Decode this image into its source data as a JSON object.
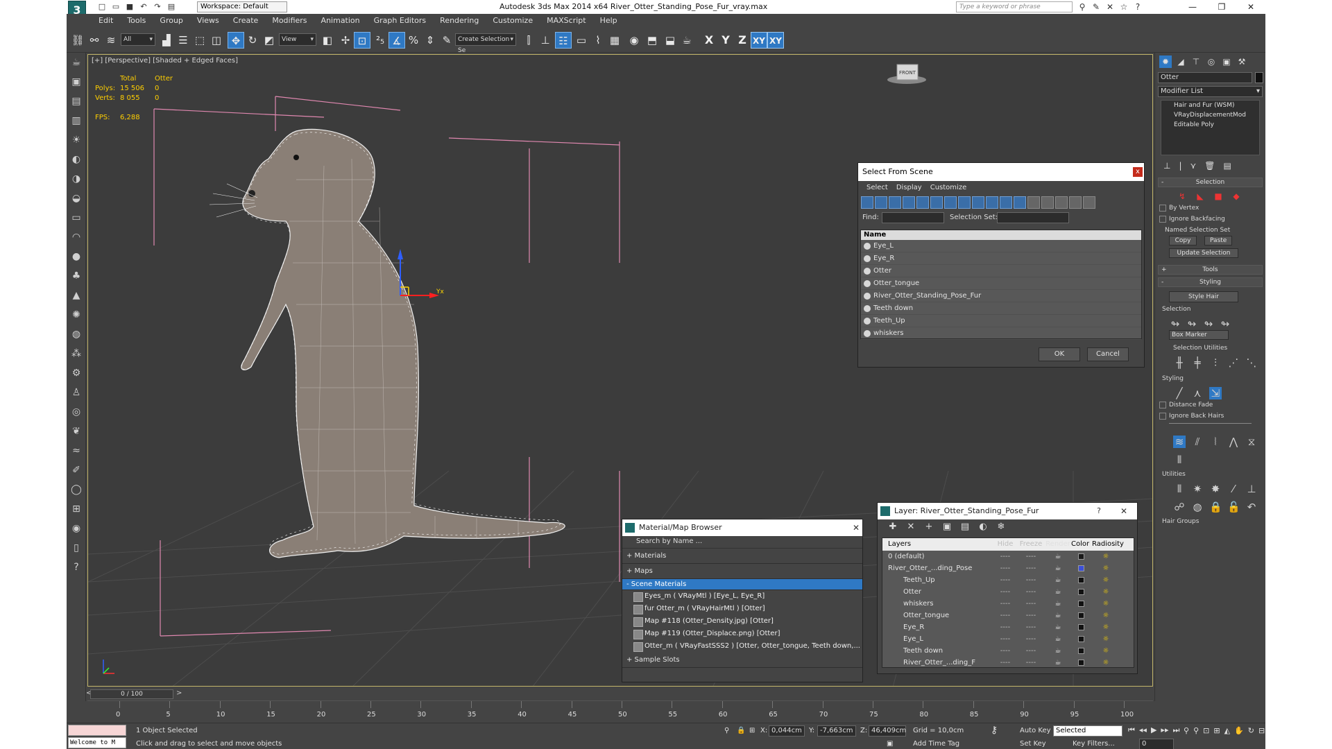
{
  "titlebar": {
    "workspace": "Workspace: Default",
    "title": "Autodesk 3ds Max  2014 x64     River_Otter_Standing_Pose_Fur_vray.max",
    "search_placeholder": "Type a keyword or phrase"
  },
  "menu": [
    "Edit",
    "Tools",
    "Group",
    "Views",
    "Create",
    "Modifiers",
    "Animation",
    "Graph Editors",
    "Rendering",
    "Customize",
    "MAXScript",
    "Help"
  ],
  "toolbar": {
    "filter": "All",
    "ref_coord": "View",
    "selection_set_placeholder": "Create Selection Se",
    "axes": [
      "X",
      "Y",
      "Z",
      "XY",
      "XY"
    ]
  },
  "viewport": {
    "label": "[+] [Perspective] [Shaded + Edged Faces]",
    "stats": {
      "col_total": "Total",
      "col_object": "Otter",
      "polys_label": "Polys:",
      "polys_total": "15 506",
      "polys_obj": "0",
      "verts_label": "Verts:",
      "verts_total": "8 055",
      "verts_obj": "0",
      "fps_label": "FPS:",
      "fps_value": "6,288"
    },
    "gizmo_label": "Yx",
    "viewcube_label": "FRONT"
  },
  "select_from_scene": {
    "title": "Select From Scene",
    "menu": [
      "Select",
      "Display",
      "Customize"
    ],
    "find_label": "Find:",
    "selection_set_label": "Selection Set:",
    "column_name": "Name",
    "items": [
      "Eye_L",
      "Eye_R",
      "Otter",
      "Otter_tongue",
      "River_Otter_Standing_Pose_Fur",
      "Teeth down",
      "Teeth_Up",
      "whiskers"
    ],
    "ok": "OK",
    "cancel": "Cancel"
  },
  "material_browser": {
    "title": "Material/Map Browser",
    "search_placeholder": "Search by Name ...",
    "sections": [
      "+ Materials",
      "+ Maps",
      "- Scene Materials",
      "+ Sample Slots"
    ],
    "scene_materials": [
      "Eyes_m  ( VRayMtl )  [Eye_L, Eye_R]",
      "fur Otter_m  ( VRayHairMtl )  [Otter]",
      "Map #118 (Otter_Density.jpg)  [Otter]",
      "Map #119 (Otter_Displace.png)  [Otter]",
      "Otter_m  ( VRayFastSSS2 )  [Otter, Otter_tongue, Teeth down,..."
    ]
  },
  "layer_manager": {
    "title": "Layer: River_Otter_Standing_Pose_Fur",
    "help": "?",
    "columns": [
      "Layers",
      "Hide",
      "Freeze",
      "Render",
      "Color",
      "Radiosity"
    ],
    "rows": [
      {
        "name": "0 (default)",
        "color": "#1a1a1a"
      },
      {
        "name": "River_Otter_...ding_Pose",
        "color": "#3b4fd8"
      },
      {
        "name": "Teeth_Up",
        "color": "#111111"
      },
      {
        "name": "Otter",
        "color": "#111111"
      },
      {
        "name": "whiskers",
        "color": "#111111"
      },
      {
        "name": "Otter_tongue",
        "color": "#111111"
      },
      {
        "name": "Eye_R",
        "color": "#111111"
      },
      {
        "name": "Eye_L",
        "color": "#111111"
      },
      {
        "name": "Teeth down",
        "color": "#111111"
      },
      {
        "name": "River_Otter_...ding_F",
        "color": "#111111"
      }
    ]
  },
  "command_panel": {
    "object_name": "Otter",
    "modifier_list": "Modifier List",
    "stack": [
      "Hair and Fur (WSM)",
      "VRayDisplacementMod",
      "Editable Poly"
    ],
    "rollouts": {
      "selection": "Selection",
      "by_vertex": "By Vertex",
      "ignore_backfacing": "Ignore Backfacing",
      "named_selection_sets": "Named Selection Set",
      "copy": "Copy",
      "paste": "Paste",
      "update_selection": "Update Selection",
      "tools": "Tools",
      "styling": "Styling",
      "style_hair": "Style Hair",
      "selection2": "Selection",
      "box_marker": "Box Marker",
      "selection_utilities": "Selection Utilities",
      "styling2": "Styling",
      "distance_fade": "Distance Fade",
      "ignore_back_hairs": "Ignore Back Hairs",
      "utilities": "Utilities",
      "hair_groups": "Hair Groups"
    }
  },
  "timeline": {
    "frame": "0 / 100",
    "ticks": [
      "0",
      "5",
      "10",
      "15",
      "20",
      "25",
      "30",
      "35",
      "40",
      "45",
      "50",
      "55",
      "60",
      "65",
      "70",
      "75",
      "80",
      "85",
      "90",
      "95",
      "100"
    ]
  },
  "status": {
    "welcome": "Welcome to M",
    "selected": "1 Object Selected",
    "hint": "Click and drag to select and move objects",
    "x_label": "X:",
    "x_value": "0,044cm",
    "y_label": "Y:",
    "y_value": "-7,663cm",
    "z_label": "Z:",
    "z_value": "46,409cm",
    "grid": "Grid = 10,0cm",
    "add_time_tag": "Add Time Tag",
    "auto_key": "Auto Key",
    "set_key": "Set Key",
    "key_mode": "Selected",
    "key_filters": "Key Filters...",
    "frame_field": "0"
  }
}
